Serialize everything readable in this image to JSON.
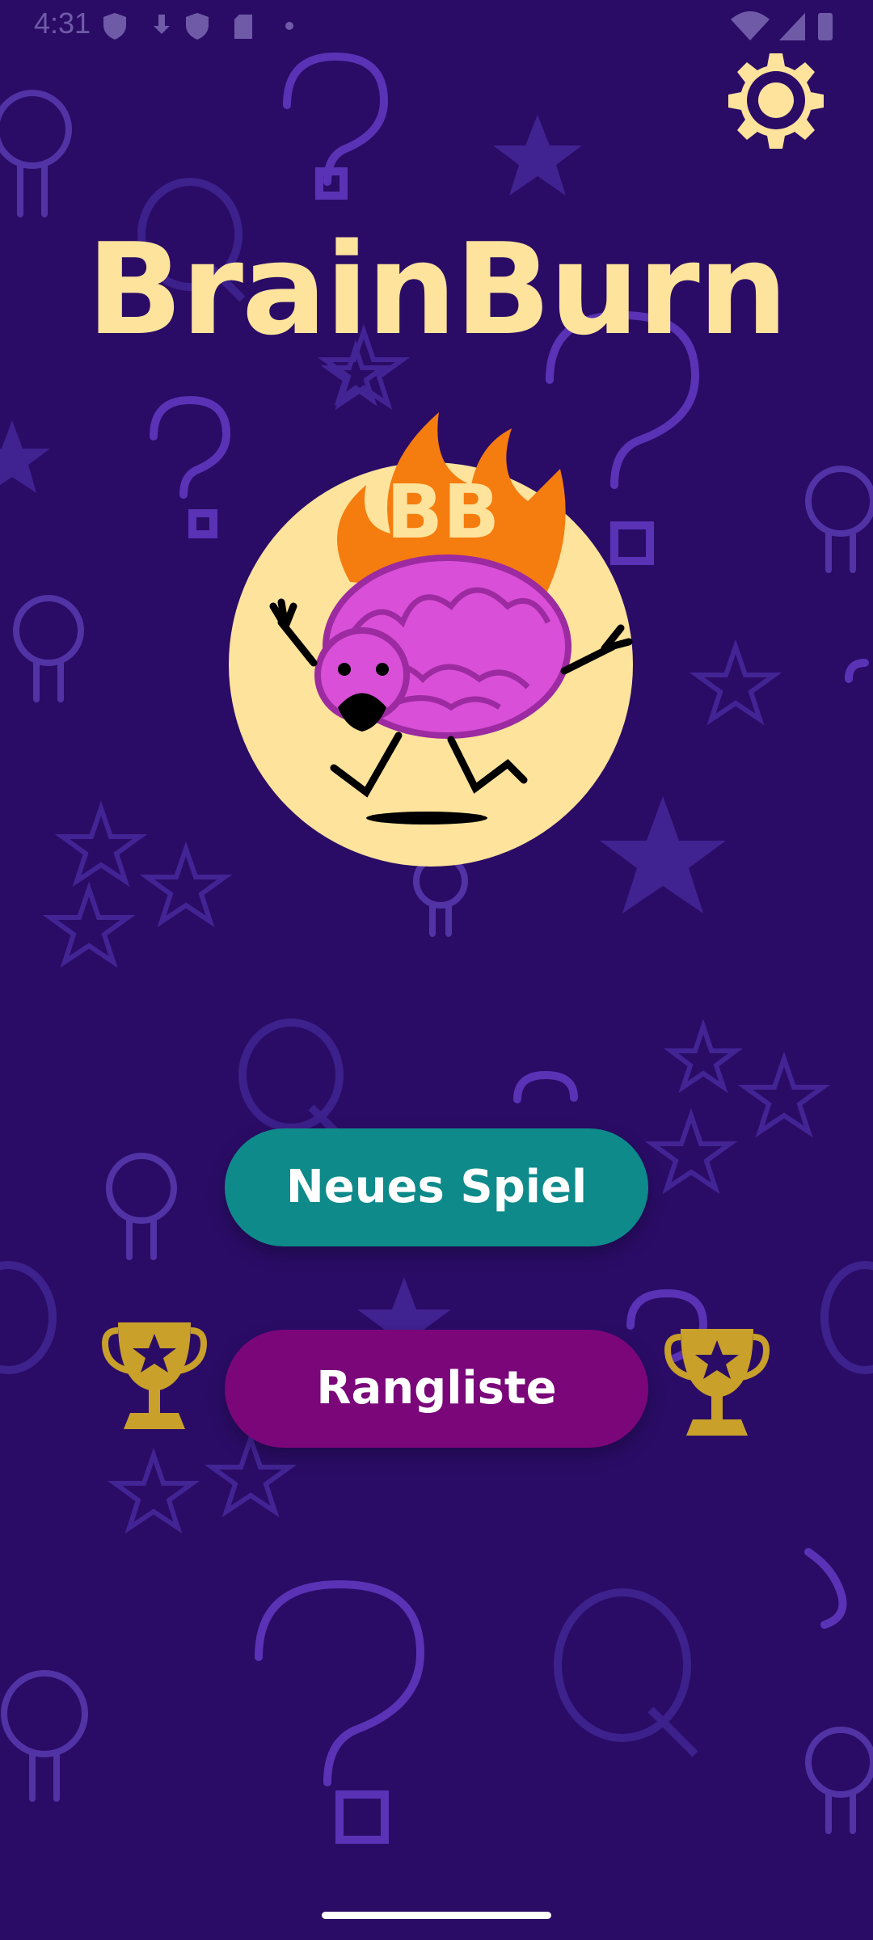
{
  "status_bar": {
    "time": "4:31",
    "icons": [
      "shield-icon",
      "download-icon",
      "play-protect-icon",
      "sd-card-icon",
      "dot-icon",
      "wifi-icon",
      "signal-icon",
      "battery-icon"
    ]
  },
  "header": {
    "settings_icon": "gear-icon"
  },
  "app": {
    "title": "BrainBurn",
    "logo_text": "BB"
  },
  "buttons": {
    "new_game_label": "Neues Spiel",
    "leaderboard_label": "Rangliste"
  },
  "colors": {
    "background": "#2a0c66",
    "title": "#fde39c",
    "new_game": "#0e8a8a",
    "leaderboard": "#7a067a",
    "trophy": "#c8a02a",
    "flame": "#f57c0f",
    "brain": "#d94fd8"
  }
}
